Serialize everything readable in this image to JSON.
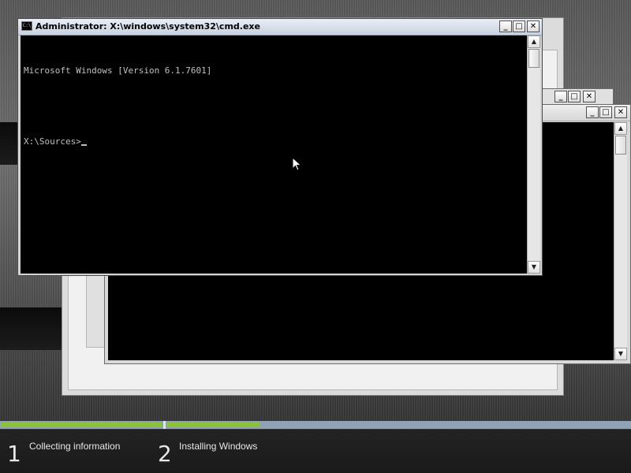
{
  "setup_background": {
    "progress": {
      "step1_fraction": 1.0,
      "step2_fraction": 0.2
    },
    "steps": [
      {
        "number": "1",
        "label": "Collecting information"
      },
      {
        "number": "2",
        "label": "Installing Windows"
      }
    ]
  },
  "cmd_window": {
    "title": "Administrator: X:\\windows\\system32\\cmd.exe",
    "icon_text": "C:\\",
    "minimize_label": "_",
    "maximize_label": "□",
    "close_label": "✕",
    "console_lines": [
      "Microsoft Windows [Version 6.1.7601]",
      "",
      "X:\\Sources>"
    ]
  },
  "background_windows": {
    "control_minimize": "_",
    "control_maximize": "□",
    "control_close": "✕"
  },
  "colors": {
    "accent_progress": "#8cc23a",
    "console_bg": "#000000",
    "console_text": "#c0c0c0"
  }
}
